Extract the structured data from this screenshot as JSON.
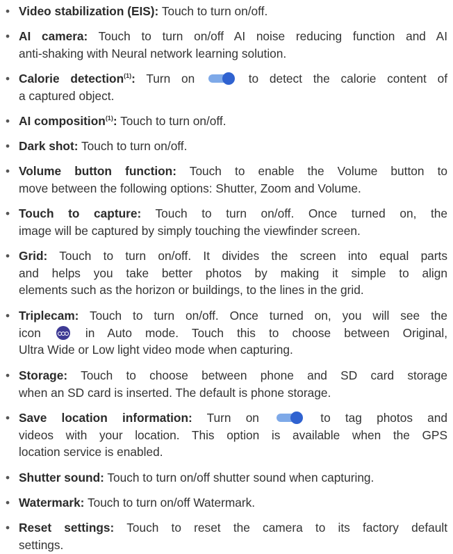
{
  "items": [
    {
      "label": "Video stabilization (EIS):",
      "lines": [
        " Touch to turn on/off."
      ]
    },
    {
      "label": "AI camera:",
      "lines": [
        " Touch to turn on/off AI noise reducing function and AI",
        "anti-shaking with Neural network learning solution."
      ]
    },
    {
      "label": "Calorie detection",
      "sup": "(1)",
      "colon": ":",
      "pre": " Turn on ",
      "post": " to detect the calorie content of",
      "line2": "a captured object."
    },
    {
      "label": "AI composition",
      "sup": "(1)",
      "colon": ":",
      "lines": [
        " Touch to turn on/off."
      ]
    },
    {
      "label": "Dark shot:",
      "lines": [
        " Touch to turn on/off."
      ]
    },
    {
      "label": "Volume button function:",
      "lines": [
        " Touch to enable the Volume button to",
        "move between the following options: Shutter, Zoom and Volume."
      ]
    },
    {
      "label": "Touch to capture:",
      "lines": [
        " Touch to turn on/off. Once turned on, the",
        "image will be captured by simply touching the viewfinder screen."
      ]
    },
    {
      "label": "Grid:",
      "lines": [
        " Touch to turn on/off. It divides the screen into equal parts",
        "and helps you take better photos by making it simple to align",
        "elements such as the horizon or buildings, to the lines in the grid."
      ]
    },
    {
      "label": "Triplecam:",
      "l1": " Touch to turn on/off. Once turned on, you will see the",
      "l2pre": "icon ",
      "l2post": " in Auto mode. Touch this to choose between Original,",
      "l3": "Ultra Wide or Low light video mode when capturing."
    },
    {
      "label": "Storage:",
      "lines": [
        " Touch to choose between phone and SD card storage",
        "when an SD card is inserted. The default is phone storage."
      ]
    },
    {
      "label": "Save location information:",
      "pre": " Turn on ",
      "post": " to tag photos and",
      "line2": "videos with your location. This option is available when the GPS",
      "line3": "location service is enabled."
    },
    {
      "label": "Shutter sound:",
      "lines": [
        " Touch to turn on/off shutter sound when capturing."
      ]
    },
    {
      "label": "Watermark:",
      "lines": [
        " Touch to turn on/off Watermark."
      ]
    },
    {
      "label": "Reset settings:",
      "lines": [
        " Touch to reset the camera to its factory default",
        "settings."
      ]
    }
  ],
  "bullet": "•",
  "colors": {
    "text": "#333333",
    "toggle_track": "#7ea9e8",
    "toggle_knob": "#2f62d0",
    "icon_bg": "#3e3a94"
  },
  "icons": {
    "toggle": "toggle-on-icon",
    "triplecam": "triplecam-icon"
  }
}
